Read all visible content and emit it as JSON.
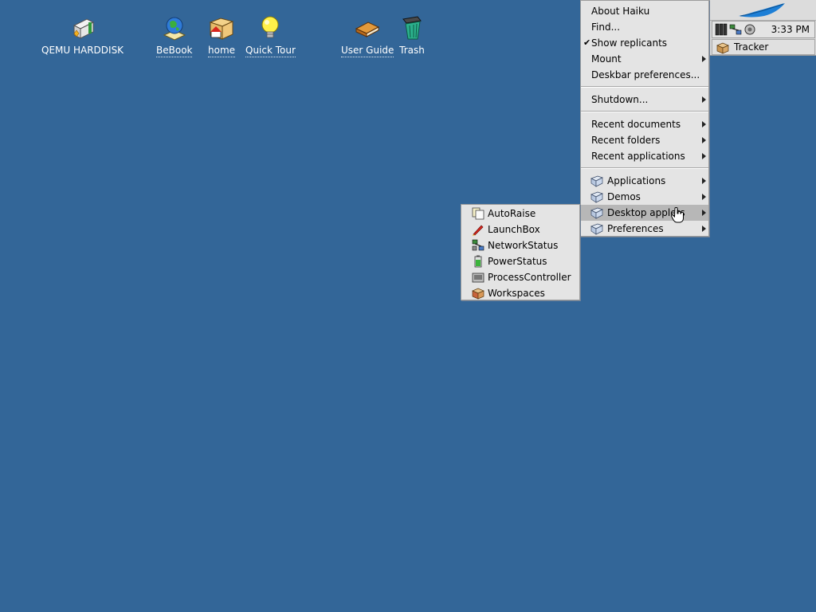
{
  "desktop": {
    "icons": [
      {
        "label": "QEMU HARDDISK",
        "icon": "harddisk-icon",
        "link": false
      },
      {
        "label": "BeBook",
        "icon": "bebook-icon",
        "link": true
      },
      {
        "label": "home",
        "icon": "home-folder-icon",
        "link": true
      },
      {
        "label": "Quick Tour",
        "icon": "lightbulb-icon",
        "link": true
      },
      {
        "label": "User Guide",
        "icon": "book-icon",
        "link": true
      },
      {
        "label": "Trash",
        "icon": "trash-icon",
        "link": false
      }
    ]
  },
  "deskbar": {
    "logo_icon": "haiku-leaf-icon",
    "tray_icons": [
      "cpu-meter-icon",
      "network-status-icon",
      "power-icon"
    ],
    "clock": "3:33 PM",
    "running_app": "Tracker",
    "running_app_icon": "tracker-icon"
  },
  "main_menu": {
    "items": [
      {
        "label": "About Haiku"
      },
      {
        "label": "Find..."
      },
      {
        "label": "Show replicants",
        "checked": true
      },
      {
        "label": "Mount",
        "submenu": true
      },
      {
        "label": "Deskbar preferences..."
      },
      {
        "label": "Shutdown...",
        "submenu": true
      },
      {
        "label": "Recent documents",
        "submenu": true
      },
      {
        "label": "Recent folders",
        "submenu": true
      },
      {
        "label": "Recent applications",
        "submenu": true
      },
      {
        "label": "Applications",
        "submenu": true,
        "icon": "folder-icon"
      },
      {
        "label": "Demos",
        "submenu": true,
        "icon": "folder-icon"
      },
      {
        "label": "Desktop applets",
        "submenu": true,
        "icon": "folder-icon",
        "selected": true
      },
      {
        "label": "Preferences",
        "submenu": true,
        "icon": "folder-icon"
      }
    ]
  },
  "desktop_applets_menu": {
    "items": [
      {
        "label": "AutoRaise",
        "icon": "autoraise-icon"
      },
      {
        "label": "LaunchBox",
        "icon": "launchbox-icon"
      },
      {
        "label": "NetworkStatus",
        "icon": "network-status-icon"
      },
      {
        "label": "PowerStatus",
        "icon": "battery-icon"
      },
      {
        "label": "ProcessController",
        "icon": "process-controller-icon"
      },
      {
        "label": "Workspaces",
        "icon": "workspaces-icon"
      }
    ]
  },
  "colors": {
    "desktop_bg": "#336698",
    "menu_bg": "#e4e4e4",
    "menu_selected": "#b7b7b7",
    "deskbar_bg": "#d8d8d8"
  }
}
